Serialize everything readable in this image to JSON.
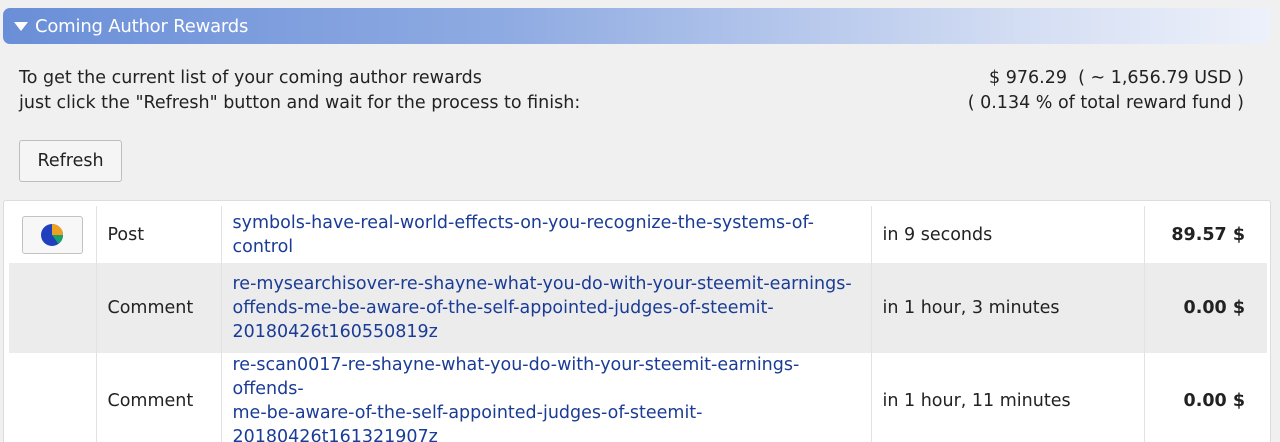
{
  "panel": {
    "title": "Coming Author Rewards"
  },
  "intro": {
    "line1": "To get the current list of your coming author rewards",
    "line2": "just click the \"Refresh\" button and wait for the process to finish:"
  },
  "totals": {
    "line1": "$ 976.29  ( ~ 1,656.79 USD )",
    "line2": "( 0.134 % of total reward fund )"
  },
  "refresh_label": "Refresh",
  "rows": [
    {
      "type": "Post",
      "permlink": "symbols-have-real-world-effects-on-you-recognize-the-systems-of-control",
      "time": "in 9 seconds",
      "amount": "89.57 $"
    },
    {
      "type": "Comment",
      "permlink_lines": [
        "re-mysearchisover-re-shayne-what-you-do-with-your-steemit-earnings-",
        "offends-me-be-aware-of-the-self-appointed-judges-of-steemit-",
        "20180426t160550819z"
      ],
      "time": "in 1 hour, 3 minutes",
      "amount": "0.00 $"
    },
    {
      "type": "Comment",
      "permlink_lines": [
        "re-scan0017-re-shayne-what-you-do-with-your-steemit-earnings-offends-",
        "me-be-aware-of-the-self-appointed-judges-of-steemit-",
        "20180426t161321907z"
      ],
      "time": "in 1 hour, 11 minutes",
      "amount": "0.00 $"
    }
  ],
  "colors": {
    "header_gradient_start": "#6a8fd8",
    "link": "#1a3c96",
    "pie_blue": "#1f3fbf",
    "pie_orange": "#f0a020",
    "pie_teal": "#1aa06a"
  },
  "icons": {
    "collapse": "triangle-down-icon",
    "progress": "pie-chart-icon"
  }
}
